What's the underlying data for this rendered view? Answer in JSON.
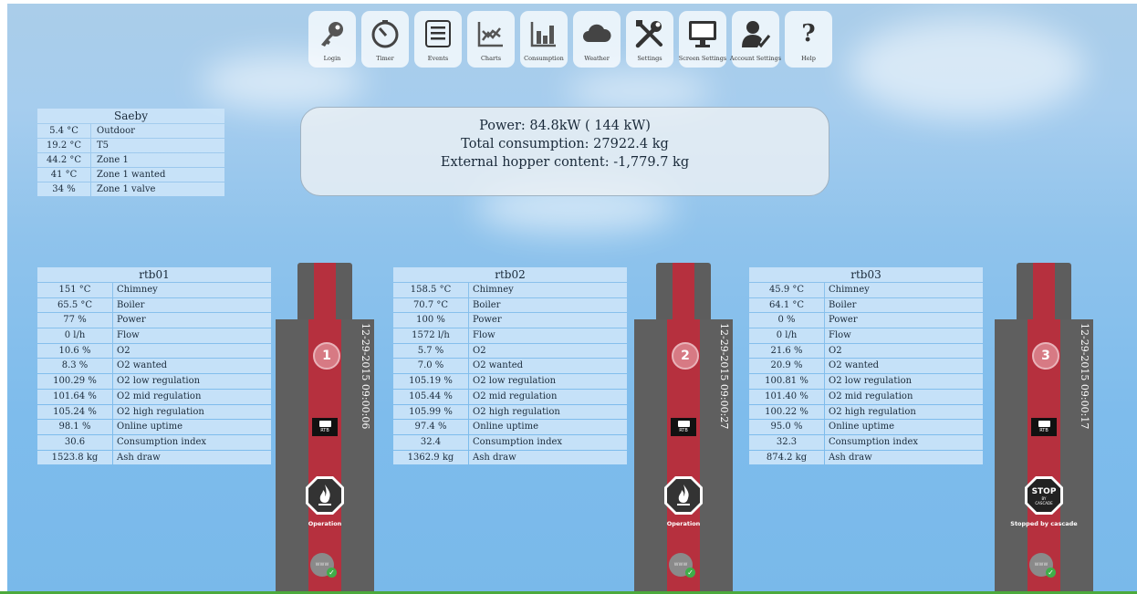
{
  "toolbar": [
    {
      "name": "login-button",
      "icon": "key-icon",
      "label": "Login"
    },
    {
      "name": "timer-button",
      "icon": "timer-icon",
      "label": "Timer"
    },
    {
      "name": "events-button",
      "icon": "list-icon",
      "label": "Events"
    },
    {
      "name": "charts-button",
      "icon": "chart-icon",
      "label": "Charts"
    },
    {
      "name": "consumption-button",
      "icon": "bar-chart-icon",
      "label": "Consumption"
    },
    {
      "name": "weather-button",
      "icon": "cloud-icon",
      "label": "Weather"
    },
    {
      "name": "settings-button",
      "icon": "tools-icon",
      "label": "Settings"
    },
    {
      "name": "screen-settings-button",
      "icon": "monitor-icon",
      "label": "Screen Settings"
    },
    {
      "name": "account-settings-button",
      "icon": "user-check-icon",
      "label": "Account Settings"
    },
    {
      "name": "help-button",
      "icon": "question-icon",
      "label": "Help"
    }
  ],
  "station": {
    "title": "Saeby",
    "rows": [
      {
        "value": "5.4 °C",
        "name": "Outdoor"
      },
      {
        "value": "19.2 °C",
        "name": "T5"
      },
      {
        "value": "44.2 °C",
        "name": "Zone 1"
      },
      {
        "value": "41 °C",
        "name": "Zone 1 wanted"
      },
      {
        "value": "34 %",
        "name": "Zone 1 valve"
      }
    ]
  },
  "summary": {
    "power": "Power: 84.8kW ( 144 kW)",
    "total": "Total consumption: 27922.4 kg",
    "hopper": "External hopper content: -1,779.7 kg"
  },
  "devices": [
    {
      "title": "rtb01",
      "number": "1",
      "date": "12-29-2015 09:00:06",
      "status": "Operation",
      "status_icon": "flame-icon",
      "rows": [
        {
          "value": "151 °C",
          "name": "Chimney"
        },
        {
          "value": "65.5 °C",
          "name": "Boiler"
        },
        {
          "value": "77 %",
          "name": "Power"
        },
        {
          "value": "0 l/h",
          "name": "Flow"
        },
        {
          "value": "10.6 %",
          "name": "O2"
        },
        {
          "value": "8.3 %",
          "name": "O2 wanted"
        },
        {
          "value": "100.29 %",
          "name": "O2 low regulation"
        },
        {
          "value": "101.64 %",
          "name": "O2 mid regulation"
        },
        {
          "value": "105.24 %",
          "name": "O2 high regulation"
        },
        {
          "value": "98.1 %",
          "name": "Online uptime"
        },
        {
          "value": "30.6",
          "name": "Consumption index"
        },
        {
          "value": "1523.8 kg",
          "name": "Ash draw"
        }
      ]
    },
    {
      "title": "rtb02",
      "number": "2",
      "date": "12-29-2015 09:00:27",
      "status": "Operation",
      "status_icon": "flame-icon",
      "rows": [
        {
          "value": "158.5 °C",
          "name": "Chimney"
        },
        {
          "value": "70.7 °C",
          "name": "Boiler"
        },
        {
          "value": "100 %",
          "name": "Power"
        },
        {
          "value": "1572 l/h",
          "name": "Flow"
        },
        {
          "value": "5.7 %",
          "name": "O2"
        },
        {
          "value": "7.0 %",
          "name": "O2 wanted"
        },
        {
          "value": "105.19 %",
          "name": "O2 low regulation"
        },
        {
          "value": "105.44 %",
          "name": "O2 mid regulation"
        },
        {
          "value": "105.99 %",
          "name": "O2 high regulation"
        },
        {
          "value": "97.4 %",
          "name": "Online uptime"
        },
        {
          "value": "32.4",
          "name": "Consumption index"
        },
        {
          "value": "1362.9 kg",
          "name": "Ash draw"
        }
      ]
    },
    {
      "title": "rtb03",
      "number": "3",
      "date": "12-29-2015 09:00:17",
      "status": "Stopped by cascade",
      "status_icon": "stop-icon",
      "rows": [
        {
          "value": "45.9 °C",
          "name": "Chimney"
        },
        {
          "value": "64.1 °C",
          "name": "Boiler"
        },
        {
          "value": "0 %",
          "name": "Power"
        },
        {
          "value": "0 l/h",
          "name": "Flow"
        },
        {
          "value": "21.6 %",
          "name": "O2"
        },
        {
          "value": "20.9 %",
          "name": "O2 wanted"
        },
        {
          "value": "100.81 %",
          "name": "O2 low regulation"
        },
        {
          "value": "101.40 %",
          "name": "O2 mid regulation"
        },
        {
          "value": "100.22 %",
          "name": "O2 high regulation"
        },
        {
          "value": "95.0 %",
          "name": "Online uptime"
        },
        {
          "value": "32.3",
          "name": "Consumption index"
        },
        {
          "value": "874.2 kg",
          "name": "Ash draw"
        }
      ]
    }
  ],
  "unit_logo_text": "RTB",
  "stop_sign": {
    "line1": "STOP",
    "line2": "BY",
    "line3": "CASCADE"
  },
  "network_label": "www"
}
